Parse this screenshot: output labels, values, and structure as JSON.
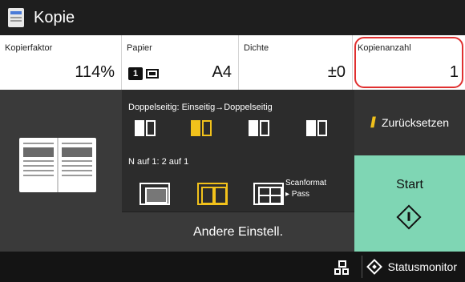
{
  "header": {
    "title": "Kopie",
    "icon": "copy-doc-icon"
  },
  "fields": {
    "copy_ratio": {
      "label": "Kopierfaktor",
      "value": "114%"
    },
    "paper": {
      "label": "Papier",
      "tray": "1",
      "value": "A4"
    },
    "density": {
      "label": "Dichte",
      "value": "±0"
    },
    "copies": {
      "label": "Kopienanzahl",
      "value": "1",
      "highlight_color": "#e03030"
    }
  },
  "settings": {
    "duplex_title": "Doppelseitig: Einseitig→Doppelseitig",
    "duplex_selected_index": 1,
    "nup_title": "N auf 1: 2 auf 1",
    "nup_selected_index": 1,
    "scan_format_label": "Scanformat",
    "scan_format_value": "▸ Pass",
    "other_settings": "Andere Einstell."
  },
  "actions": {
    "reset": "Zurücksetzen",
    "start": "Start"
  },
  "statusbar": {
    "status_monitor": "Statusmonitor"
  },
  "colors": {
    "accent": "#f2c21b",
    "start_bg": "#7fd6b4",
    "highlight": "#e03030"
  }
}
